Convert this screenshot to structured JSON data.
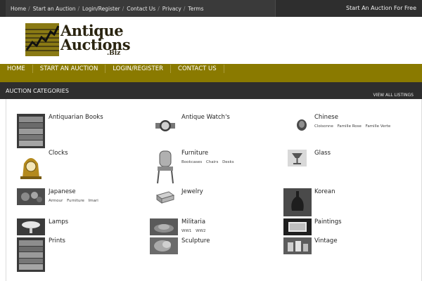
{
  "topbar": {
    "links": [
      "Home",
      "Start an Auction",
      "Login/Register",
      "Contact Us",
      "Privacy",
      "Terms"
    ],
    "separator": "/",
    "cta": "Start An Auction For Free"
  },
  "logo": {
    "line1": "Antique",
    "line2": "Auctions",
    "line3": ".Biz"
  },
  "mainnav": [
    "HOME",
    "START AN AUCTION",
    "LOGIN/REGISTER",
    "CONTACT US"
  ],
  "categories_bar": {
    "title": "AUCTION CATEGORIES",
    "view_all": "VIEW ALL LISTINGS"
  },
  "categories": [
    {
      "name": "Antiquarian Books",
      "subs": [],
      "icon": "books-icon"
    },
    {
      "name": "Antique Watch's",
      "subs": [],
      "icon": "watch-icon"
    },
    {
      "name": "Chinese",
      "subs": [
        "Cloisonne",
        "Famille Rose",
        "Famille Verte"
      ],
      "icon": "vase-icon"
    },
    {
      "name": "Clocks",
      "subs": [],
      "icon": "clock-icon"
    },
    {
      "name": "Furniture",
      "subs": [
        "Bookcases",
        "Chairs",
        "Desks"
      ],
      "icon": "chair-icon"
    },
    {
      "name": "Glass",
      "subs": [],
      "icon": "glass-icon"
    },
    {
      "name": "Japanese",
      "subs": [
        "Armour",
        "Furniture",
        "Imari"
      ],
      "icon": "japanese-icon"
    },
    {
      "name": "Jewelry",
      "subs": [],
      "icon": "jewelry-icon"
    },
    {
      "name": "Korean",
      "subs": [],
      "icon": "korean-vase-icon"
    },
    {
      "name": "Lamps",
      "subs": [],
      "icon": "lamp-icon"
    },
    {
      "name": "Militaria",
      "subs": [
        "WW1",
        "WW2"
      ],
      "icon": "militaria-icon"
    },
    {
      "name": "Paintings",
      "subs": [],
      "icon": "painting-icon"
    },
    {
      "name": "Prints",
      "subs": [],
      "icon": "prints-icon"
    },
    {
      "name": "Sculpture",
      "subs": [],
      "icon": "sculpture-icon"
    },
    {
      "name": "Vintage",
      "subs": [],
      "icon": "vintage-icon"
    }
  ],
  "colors": {
    "topbar": "#2e2e2e",
    "nav_gold": "#8a7a00",
    "logo_mark": "#8a7a14"
  }
}
